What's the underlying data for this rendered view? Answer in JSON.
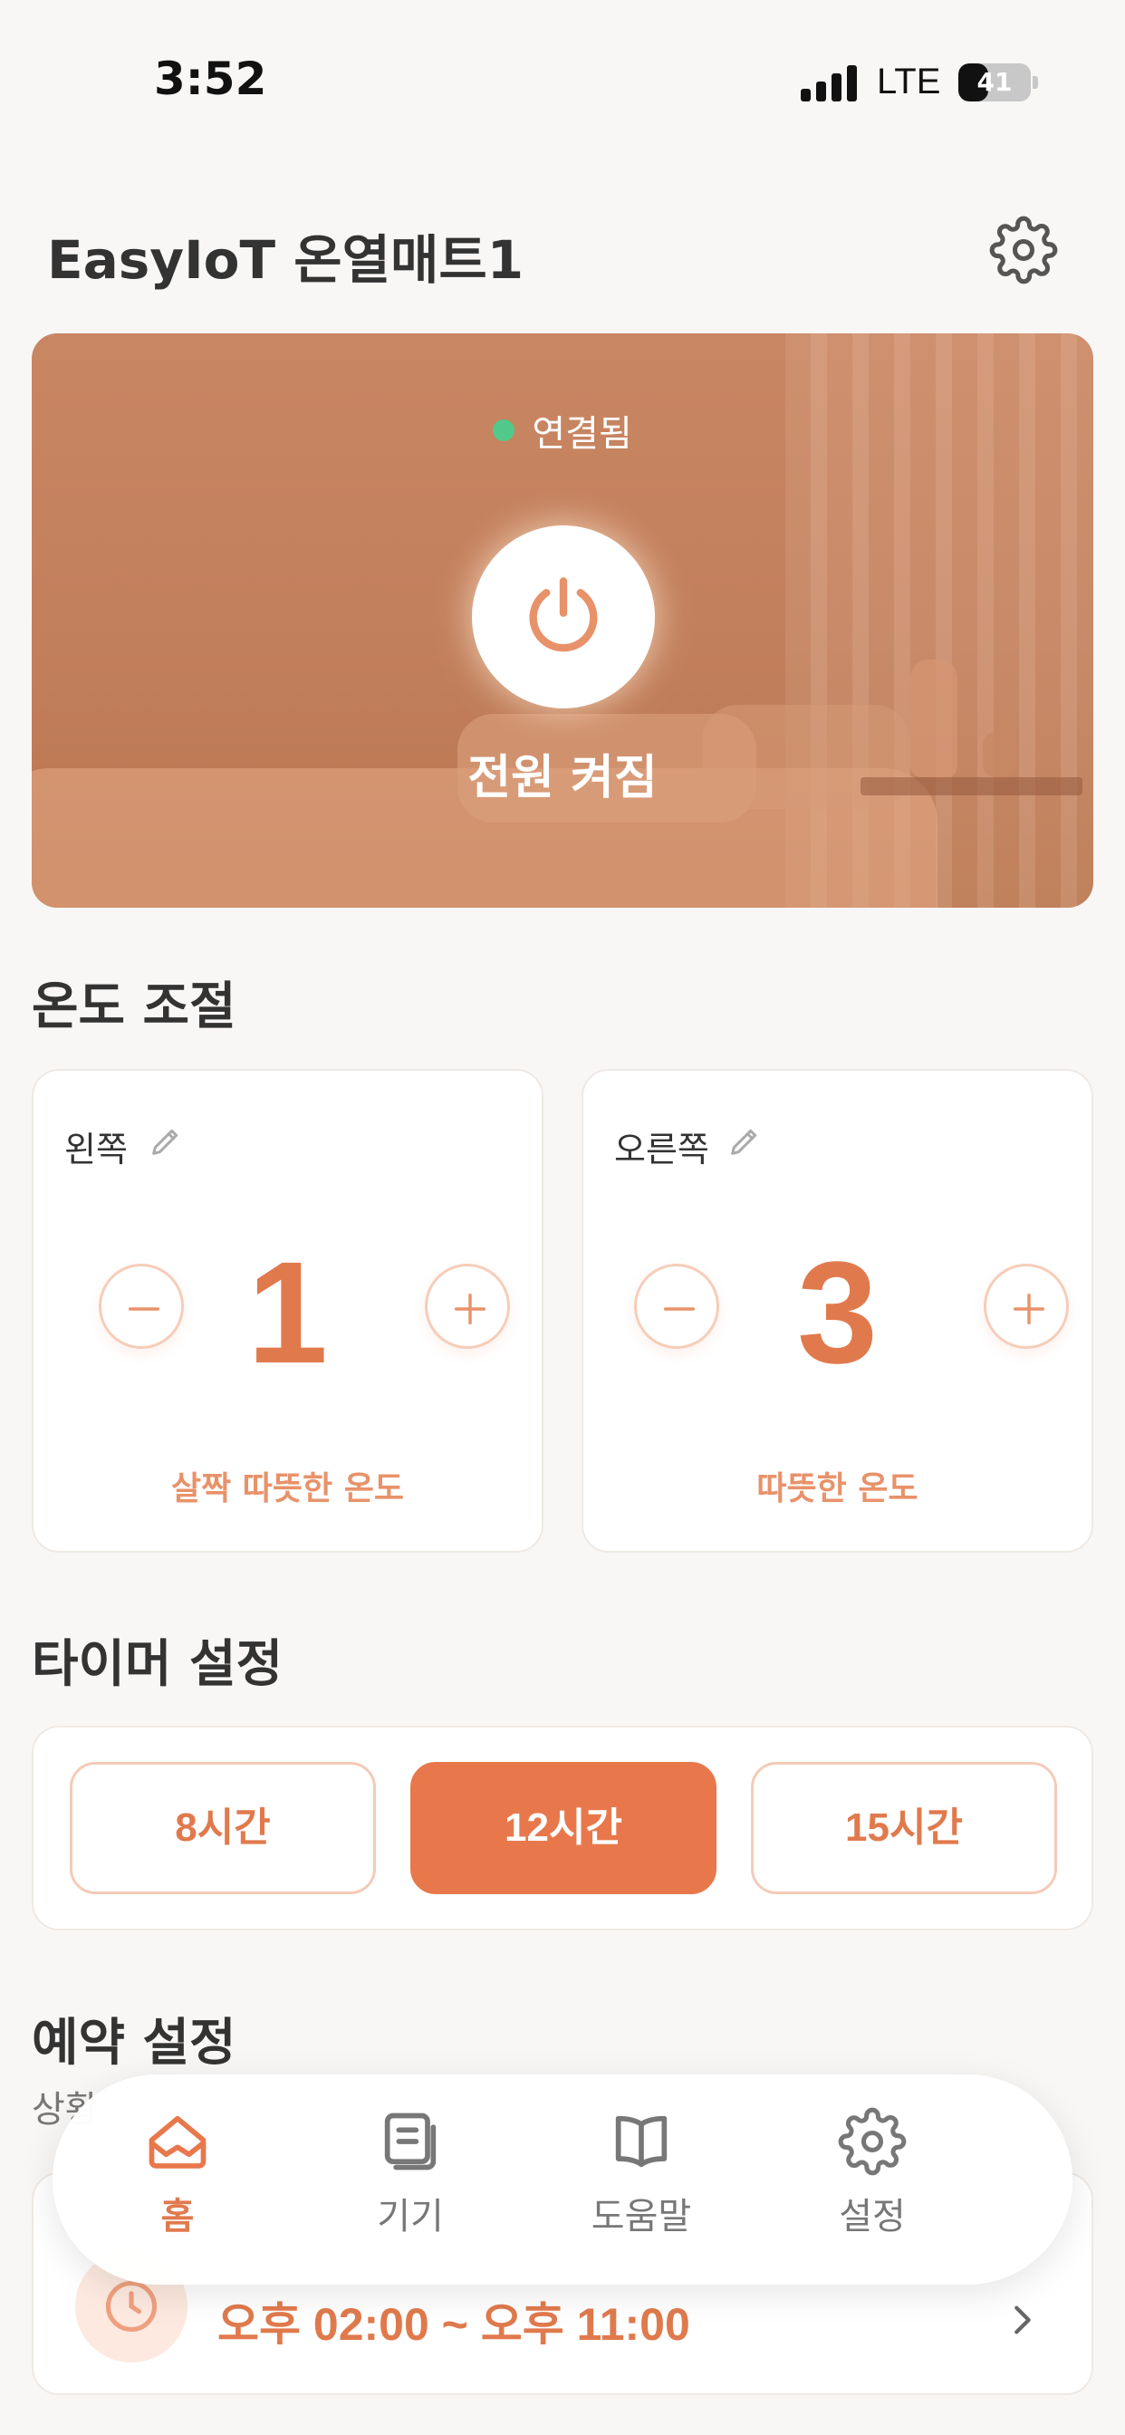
{
  "status_bar": {
    "time": "3:52",
    "network": "LTE",
    "battery": "41",
    "battery_level": 0.41
  },
  "header": {
    "title": "EasyIoT 온열매트1"
  },
  "hero": {
    "connection_status": "연결됨",
    "power_label": "전원 켜짐"
  },
  "temperature": {
    "section_title": "온도 조절",
    "zones": [
      {
        "label": "왼쪽",
        "level": "1",
        "description": "살짝 따뜻한 온도"
      },
      {
        "label": "오른쪽",
        "level": "3",
        "description": "따뜻한 온도"
      }
    ]
  },
  "timer": {
    "section_title": "타이머 설정",
    "options": [
      {
        "label": "8시간",
        "selected": false
      },
      {
        "label": "12시간",
        "selected": true
      },
      {
        "label": "15시간",
        "selected": false
      }
    ]
  },
  "reservation": {
    "section_title": "예약 설정",
    "subtitle": "상황",
    "time_range": "오후 02:00 ~ 오후 11:00"
  },
  "bottom_nav": {
    "items": [
      {
        "label": "홈",
        "icon": "home-icon",
        "active": true
      },
      {
        "label": "기기",
        "icon": "devices-icon",
        "active": false
      },
      {
        "label": "도움말",
        "icon": "help-book-icon",
        "active": false
      },
      {
        "label": "설정",
        "icon": "gear-icon",
        "active": false
      }
    ]
  },
  "colors": {
    "accent": "#e8784c",
    "connected": "#52c98a",
    "background": "#f9f7f5"
  }
}
